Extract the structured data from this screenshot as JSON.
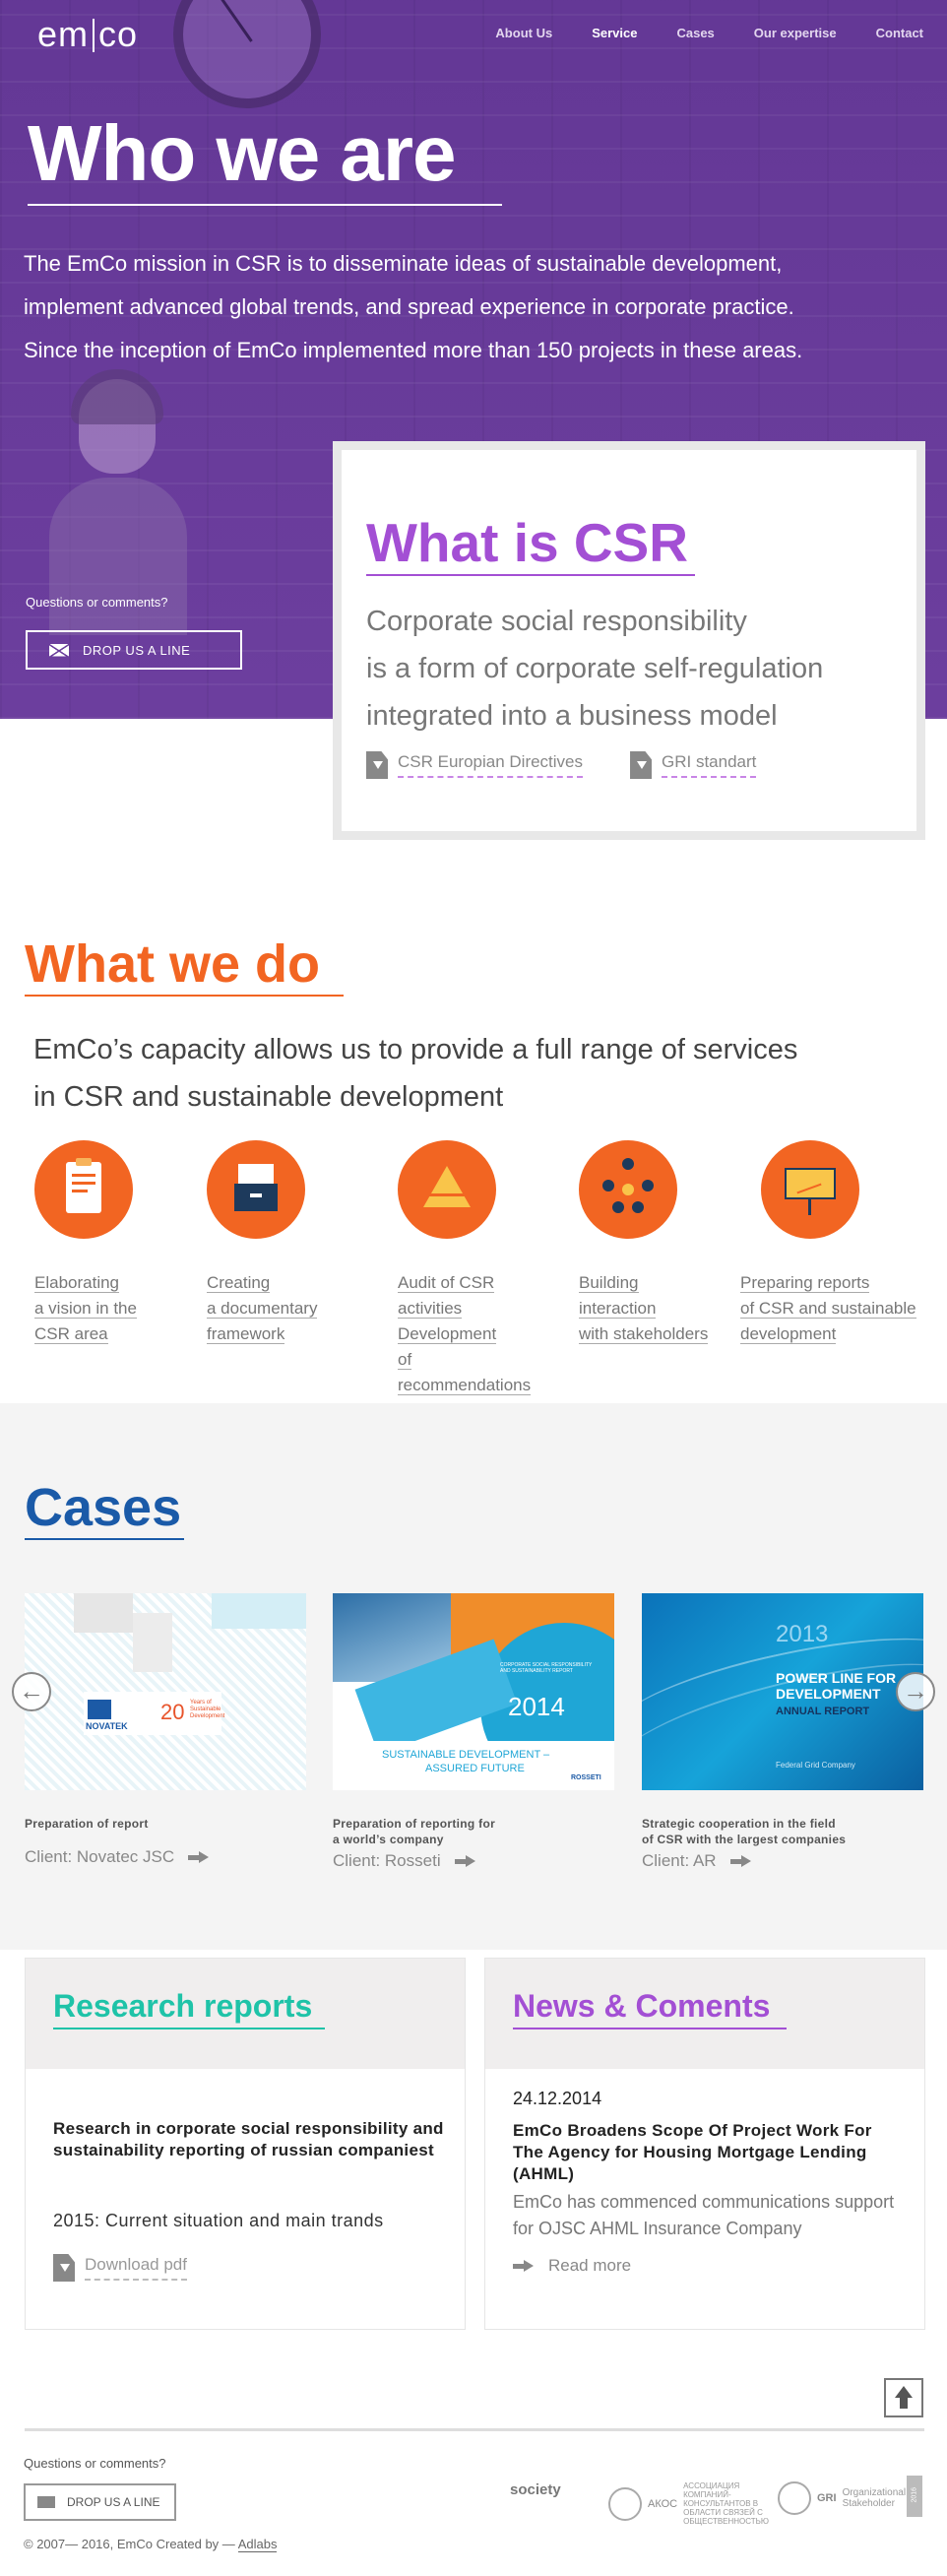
{
  "header": {
    "logo_left": "em",
    "logo_right": "co",
    "nav": [
      "About Us",
      "Service",
      "Cases",
      "Our expertise",
      "Contact"
    ],
    "active_nav": "Service"
  },
  "hero": {
    "title": "Who we are",
    "mission_lines": [
      "The EmCo mission in CSR is to disseminate ideas of sustainable development,",
      "implement advanced global trends, and spread experience in corporate practice.",
      "Since the inception of EmCo implemented more than 150 projects in these areas."
    ],
    "questions": "Questions or comments?",
    "drop_button": "DROP US A LINE"
  },
  "csr": {
    "title": "What is CSR",
    "definition_lines": [
      "Corporate social responsibility",
      "is a form of corporate self-regulation",
      "integrated into a business model"
    ],
    "links": [
      "CSR Europian Directives",
      "GRI standart"
    ]
  },
  "what_we_do": {
    "title": "What we do",
    "subtitle_lines": [
      "EmCo’s capacity allows us to provide a full range of services",
      "in CSR and sustainable development"
    ],
    "services": [
      {
        "icon": "clipboard-icon",
        "lines": [
          "Elaborating",
          "a vision in the",
          "CSR area"
        ]
      },
      {
        "icon": "document-box-icon",
        "lines": [
          "Creating",
          "a documentary",
          "framework"
        ]
      },
      {
        "icon": "pyramid-icon",
        "lines": [
          "Audit of CSR activities",
          "Development",
          "of recommendations"
        ]
      },
      {
        "icon": "people-network-icon",
        "lines": [
          "Building",
          "interaction",
          "with stakeholders"
        ]
      },
      {
        "icon": "presentation-board-icon",
        "lines": [
          "Preparing reports",
          "of CSR and sustainable",
          "development"
        ]
      }
    ]
  },
  "cases": {
    "title": "Cases",
    "items": [
      {
        "cover": {
          "brand": "NOVATEK",
          "big": "20",
          "small": "Years of Sustainable Development"
        },
        "desc_lines": [
          "Preparation of report"
        ],
        "client": "Client: Novatec JSC"
      },
      {
        "cover": {
          "year": "2014",
          "tag": "CORPORATE SOCIAL RESPONSIBILITY AND SUSTAINABILITY REPORT",
          "slogan1": "SUSTAINABLE DEVELOPMENT –",
          "slogan2": "ASSURED FUTURE",
          "brand": "ROSSETI"
        },
        "desc_lines": [
          "Preparation of reporting for",
          "a world’s company"
        ],
        "client": "Client: Rosseti"
      },
      {
        "cover": {
          "year": "2013",
          "line1": "POWER LINE FOR",
          "line2": "DEVELOPMENT",
          "line3": "ANNUAL REPORT",
          "brand": "Federal Grid Company"
        },
        "desc_lines": [
          "Strategic cooperation in the field",
          "of CSR with the largest companies"
        ],
        "client": "Client: AR"
      }
    ]
  },
  "research": {
    "title": "Research reports",
    "report_title": "Research in corporate social responsibility and sustainability reporting of russian companiest",
    "year_line": "2015: Current situation and main trands",
    "download": "Download pdf"
  },
  "news": {
    "title": "News & Coments",
    "date": "24.12.2014",
    "headline": "EmCo Broadens Scope Of Project Work For The Agency for Housing Mortgage Lending (AHML)",
    "text": "EmCo has commenced communications support for OJSC AHML Insurance Company",
    "read_more": "Read more"
  },
  "footer": {
    "questions": "Questions or comments?",
    "drop_button": "DROP US A LINE",
    "copyright": "© 2007— 2016, EmCo   Created by — ",
    "creator": "Adlabs",
    "partners": [
      {
        "name": "society",
        "sub": ""
      },
      {
        "name": "АКОС",
        "sub": "АССОЦИАЦИЯ КОМПАНИЙ-КОНСУЛЬТАНТОВ В ОБЛАСТИ СВЯЗЕЙ С ОБЩЕСТВЕННОСТЬЮ"
      },
      {
        "name": "GRI",
        "sub": "Organizational Stakeholder"
      }
    ],
    "badge": "2016"
  },
  "colors": {
    "hero_purple": "#6a3d9c",
    "csr_violet": "#a34fd4",
    "orange": "#f26522",
    "cases_blue": "#1a5aa8",
    "research_teal": "#1fc3a8",
    "news_violet": "#a34fd4"
  }
}
